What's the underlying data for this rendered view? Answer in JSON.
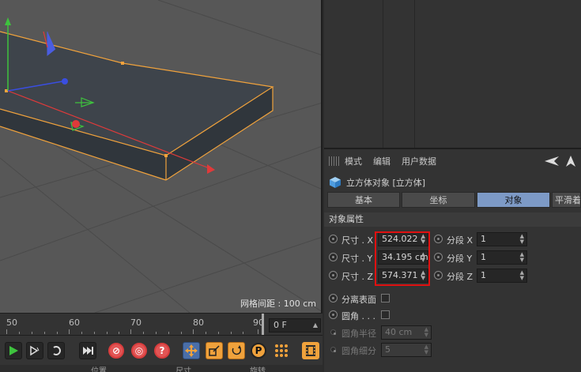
{
  "viewport": {
    "grid_label": "网格间距 : 100 cm"
  },
  "timeline": {
    "ticks": [
      "50",
      "60",
      "70",
      "80",
      "90"
    ],
    "frame_value": "0 F"
  },
  "transport": {
    "buttons": [
      "play",
      "next-key",
      "loop",
      "end",
      "record-key",
      "autokey",
      "help",
      "move",
      "scale",
      "rotate",
      "point",
      "dots",
      "film"
    ]
  },
  "bottom_bar": {
    "labels": [
      "位置",
      "尺寸",
      "旋转"
    ]
  },
  "attributes": {
    "menu": [
      "模式",
      "编辑",
      "用户数据"
    ],
    "object_title": "立方体对象 [立方体]",
    "tabs": [
      "基本",
      "坐标",
      "对象",
      "平滑着"
    ],
    "active_tab": "对象",
    "section": "对象属性",
    "size_rows": [
      {
        "label": "尺寸 . X",
        "value": "524.022 c",
        "seg_label": "分段 X",
        "seg_value": "1"
      },
      {
        "label": "尺寸 . Y",
        "value": "34.195 cm",
        "seg_label": "分段 Y",
        "seg_value": "1"
      },
      {
        "label": "尺寸 . Z",
        "value": "574.371 c",
        "seg_label": "分段 Z",
        "seg_value": "1"
      }
    ],
    "separate_surfaces": "分离表面",
    "fillet": "圆角 . . .",
    "fillet_radius": {
      "label": "圆角半径",
      "value": "40 cm"
    },
    "fillet_subdiv": {
      "label": "圆角细分",
      "value": "5"
    }
  },
  "colors": {
    "active_tab": "#7d9ac6",
    "highlight": "#e01010",
    "accent": "#f0a23c"
  }
}
